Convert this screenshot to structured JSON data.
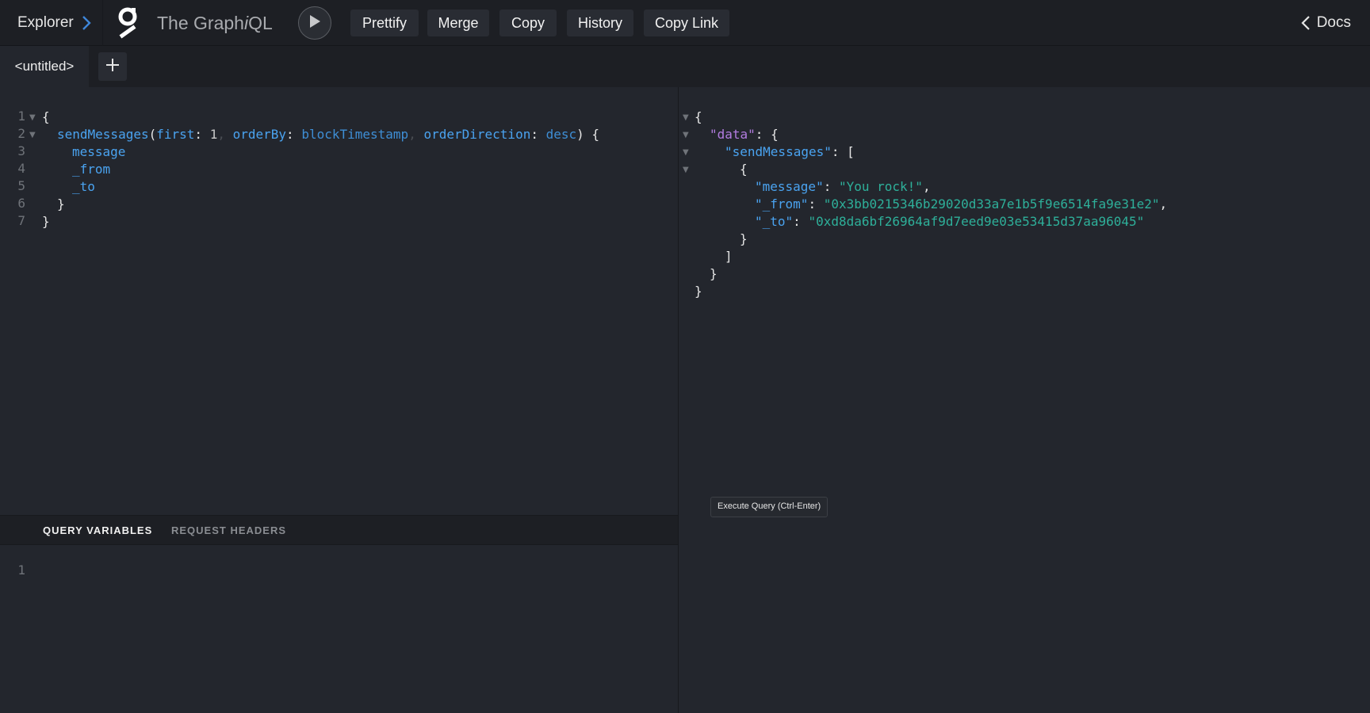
{
  "topbar": {
    "explorer_label": "Explorer",
    "app_title_prefix": "The Graph",
    "app_title_italic": "i",
    "app_title_suffix": "QL",
    "buttons": [
      "Prettify",
      "Merge",
      "Copy",
      "History",
      "Copy Link"
    ],
    "docs_label": "Docs"
  },
  "tabs": {
    "active": "<untitled>",
    "add_icon": "plus-icon"
  },
  "query": {
    "line_numbers": [
      "1",
      "2",
      "3",
      "4",
      "5",
      "6",
      "7"
    ],
    "l1": "{",
    "l2_field": "sendMessages",
    "l2_open": "(",
    "arg1_name": "first",
    "colon": ":",
    "arg1_value": "1",
    "comma": ",",
    "arg2_name": "orderBy",
    "arg2_value": "blockTimestamp",
    "arg3_name": "orderDirection",
    "arg3_value": "desc",
    "l2_close": ")",
    "l2_brace": "{",
    "l3": "message",
    "l4": "_from",
    "l5": "_to",
    "l6": "}",
    "l7": "}"
  },
  "variables": {
    "tab_query_variables": "QUERY VARIABLES",
    "tab_request_headers": "REQUEST HEADERS",
    "line_number": "1"
  },
  "result": {
    "open": "{",
    "data_key": "\"data\"",
    "send_key": "\"sendMessages\"",
    "bracket_open": "[",
    "obj_open": "{",
    "message_key": "\"message\"",
    "message_value": "\"You rock!\"",
    "from_key": "\"_from\"",
    "from_value": "\"0x3bb0215346b29020d33a7e1b5f9e6514fa9e31e2\"",
    "to_key": "\"_to\"",
    "to_value": "\"0xd8da6bf26964af9d7eed9e03e53415d37aa96045\"",
    "obj_close": "}",
    "bracket_close": "]",
    "data_close": "}",
    "close": "}",
    "colon_brace": ": {",
    "colon_bracket": ": [",
    "colon_sp": ": ",
    "comma": ","
  },
  "tooltip": "Execute Query (Ctrl-Enter)",
  "colors": {
    "background": "#23262d",
    "topbar": "#1d1f24",
    "field": "#4aa3f0",
    "string": "#2eb09a",
    "purple_key": "#b27ce0"
  }
}
